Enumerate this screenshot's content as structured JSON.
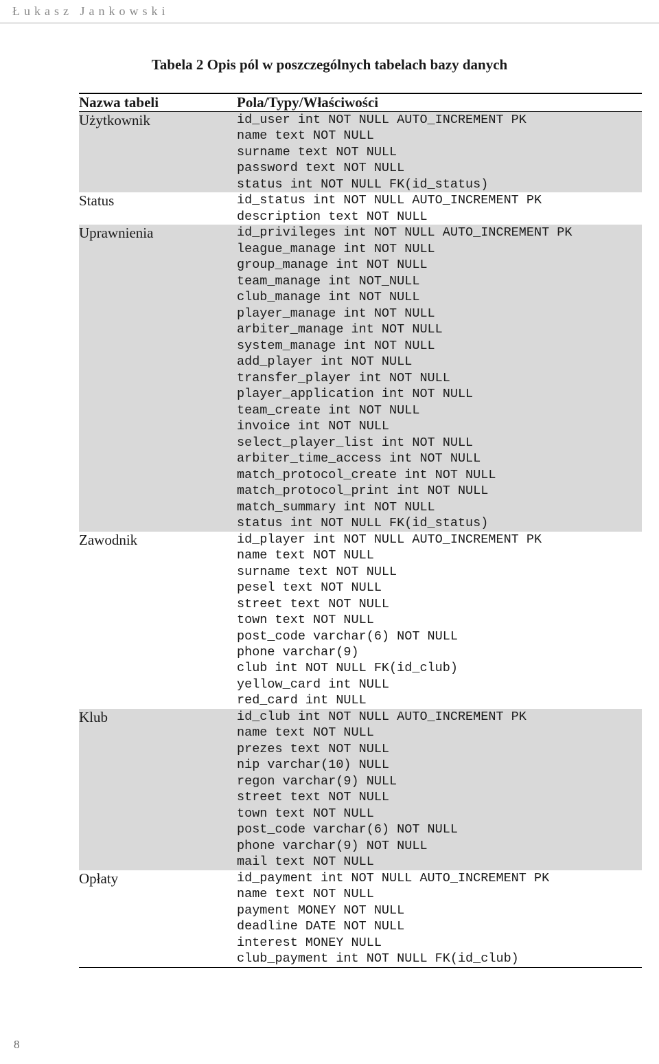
{
  "running_header": "Łukasz Jankowski",
  "caption": "Tabela 2 Opis pól w poszczególnych tabelach bazy danych",
  "header": {
    "left": "Nazwa tabeli",
    "right": "Pola/Typy/Właściwości"
  },
  "rows": [
    {
      "name": "Użytkownik",
      "fields": "id_user int NOT NULL AUTO_INCREMENT PK\nname text NOT NULL\nsurname text NOT NULL\npassword text NOT NULL\nstatus int NOT NULL FK(id_status)"
    },
    {
      "name": "Status",
      "fields": "id_status int NOT NULL AUTO_INCREMENT PK\ndescription text NOT NULL"
    },
    {
      "name": "Uprawnienia",
      "fields": "id_privileges int NOT NULL AUTO_INCREMENT PK\nleague_manage int NOT NULL\ngroup_manage int NOT NULL\nteam_manage int NOT_NULL\nclub_manage int NOT NULL\nplayer_manage int NOT NULL\narbiter_manage int NOT NULL\nsystem_manage int NOT NULL\nadd_player int NOT NULL\ntransfer_player int NOT NULL\nplayer_application int NOT NULL\nteam_create int NOT NULL\ninvoice int NOT NULL\nselect_player_list int NOT NULL\narbiter_time_access int NOT NULL\nmatch_protocol_create int NOT NULL\nmatch_protocol_print int NOT NULL\nmatch_summary int NOT NULL\nstatus int NOT NULL FK(id_status)"
    },
    {
      "name": "Zawodnik",
      "fields": "id_player int NOT NULL AUTO_INCREMENT PK\nname text NOT NULL\nsurname text NOT NULL\npesel text NOT NULL\nstreet text NOT NULL\ntown text NOT NULL\npost_code varchar(6) NOT NULL\nphone varchar(9)\nclub int NOT NULL FK(id_club)\nyellow_card int NULL\nred_card int NULL"
    },
    {
      "name": "Klub",
      "fields": "id_club int NOT NULL AUTO_INCREMENT PK\nname text NOT NULL\nprezes text NOT NULL\nnip varchar(10) NULL\nregon varchar(9) NULL\nstreet text NOT NULL\ntown text NOT NULL\npost_code varchar(6) NOT NULL\nphone varchar(9) NOT NULL\nmail text NOT NULL"
    },
    {
      "name": "Opłaty",
      "fields": "id_payment int NOT NULL AUTO_INCREMENT PK\nname text NOT NULL\npayment MONEY NOT NULL\ndeadline DATE NOT NULL\ninterest MONEY NULL\nclub_payment int NOT NULL FK(id_club)"
    }
  ],
  "page_number": "8"
}
